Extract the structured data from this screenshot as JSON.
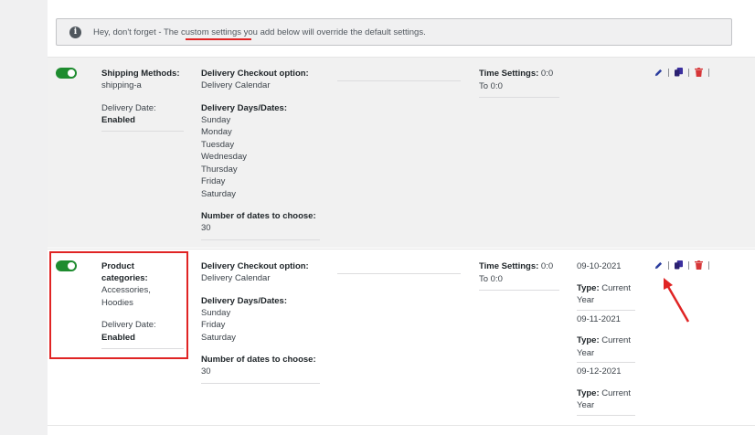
{
  "notice": {
    "prefix": "Hey, don't forget - The ",
    "link": "custom settings",
    "suffix": " you add below will override the default settings."
  },
  "rows": [
    {
      "scope_label": "Shipping Methods:",
      "scope_value": "shipping-a",
      "date_label": "Delivery Date:",
      "date_value": "Enabled",
      "checkout_label": "Delivery Checkout option:",
      "checkout_value": "Delivery Calendar",
      "days_label": "Delivery Days/Dates:",
      "days": [
        "Sunday",
        "Monday",
        "Tuesday",
        "Wednesday",
        "Thursday",
        "Friday",
        "Saturday"
      ],
      "num_label": "Number of dates to choose:",
      "num_value": "30",
      "time_label": "Time Settings:",
      "time_value_a": "0:0",
      "time_value_b": "To 0:0"
    },
    {
      "scope_label_a": "Product",
      "scope_label_b": "categories:",
      "scope_value_a": "Accessories,",
      "scope_value_b": "Hoodies",
      "date_label": "Delivery Date:",
      "date_value": "Enabled",
      "checkout_label": "Delivery Checkout option:",
      "checkout_value": "Delivery Calendar",
      "days_label": "Delivery Days/Dates:",
      "days": [
        "Sunday",
        "Friday",
        "Saturday"
      ],
      "num_label": "Number of dates to choose:",
      "num_value": "30",
      "time_label": "Time Settings:",
      "time_value_a": "0:0",
      "time_value_b": "To 0:0",
      "specific_dates": [
        {
          "date": "09-10-2021",
          "type_label": "Type:",
          "type_a": "Current",
          "type_b": "Year"
        },
        {
          "date": "09-11-2021",
          "type_label": "Type:",
          "type_a": "Current",
          "type_b": "Year"
        },
        {
          "date": "09-12-2021",
          "type_label": "Type:",
          "type_a": "Current",
          "type_b": "Year"
        }
      ]
    }
  ],
  "colors": {
    "toggle_on": "#1e8c2f",
    "edit": "#2c3e9e",
    "copy": "#3b2f9e",
    "delete": "#d63638",
    "annotation": "#e02424"
  }
}
